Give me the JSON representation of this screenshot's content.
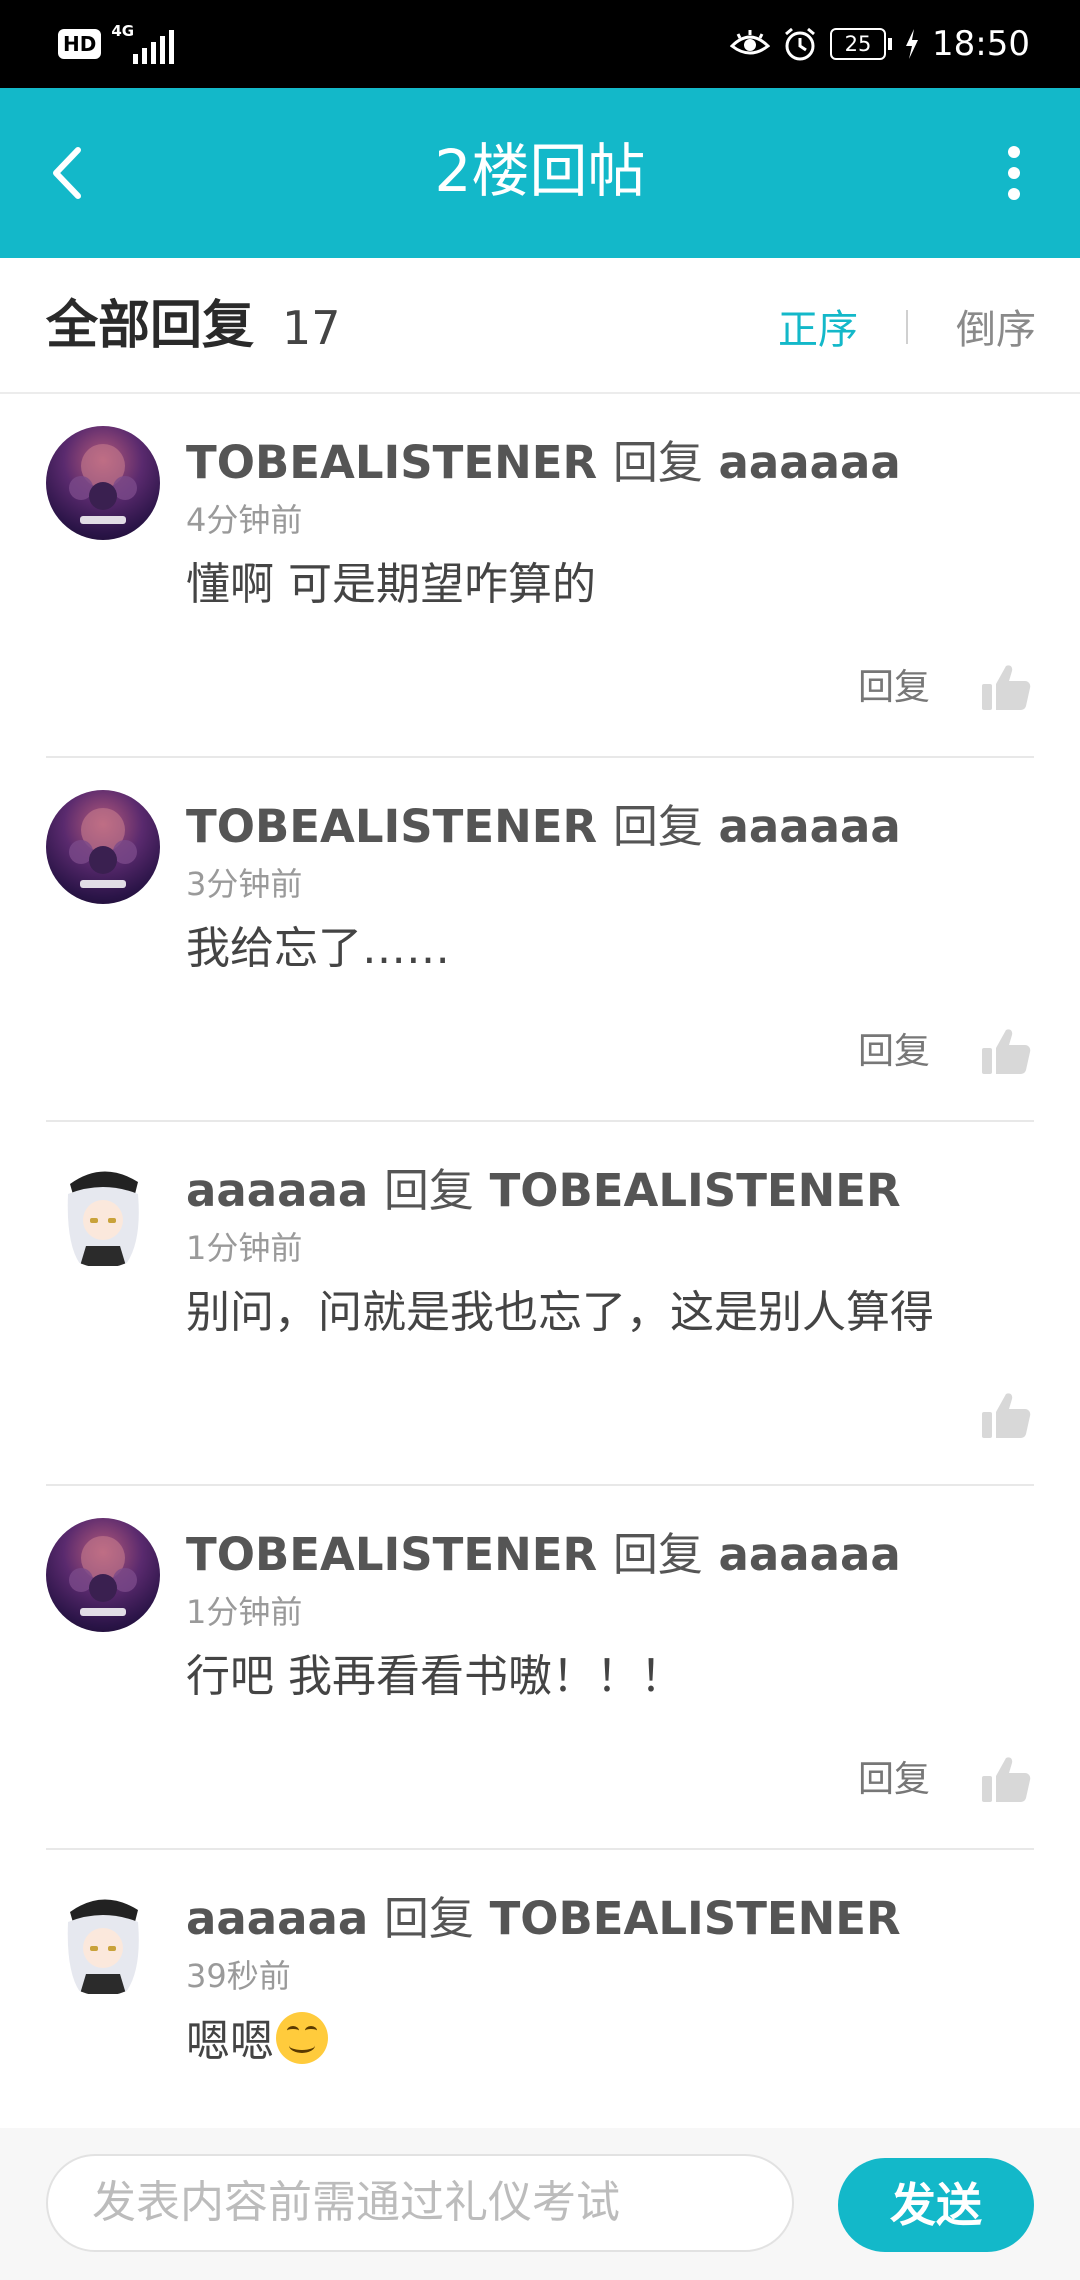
{
  "status_bar": {
    "hd": "HD",
    "network": "4G",
    "battery": "25",
    "time": "18:50"
  },
  "app_bar": {
    "title": "2楼回帖"
  },
  "reply_header": {
    "title": "全部回复",
    "count": "17",
    "sort_asc": "正序",
    "sort_desc": "倒序"
  },
  "replies": [
    {
      "user": "TOBEALISTENER",
      "verb": "回复",
      "target": "aaaaaa",
      "time": "4分钟前",
      "content": "懂啊 可是期望咋算的",
      "reply_label": "回复",
      "avatar": "avengers-poster"
    },
    {
      "user": "TOBEALISTENER",
      "verb": "回复",
      "target": "aaaaaa",
      "time": "3分钟前",
      "content": "我给忘了……",
      "reply_label": "回复",
      "avatar": "avengers-poster"
    },
    {
      "user": "aaaaaa",
      "verb": "回复",
      "target": "TOBEALISTENER",
      "time": "1分钟前",
      "content": "别问，问就是我也忘了，这是别人算得",
      "reply_label": "",
      "avatar": "anime-girl"
    },
    {
      "user": "TOBEALISTENER",
      "verb": "回复",
      "target": "aaaaaa",
      "time": "1分钟前",
      "content": "行吧 我再看看书嗷！！！",
      "reply_label": "回复",
      "avatar": "avengers-poster"
    },
    {
      "user": "aaaaaa",
      "verb": "回复",
      "target": "TOBEALISTENER",
      "time": "39秒前",
      "content": "嗯嗯",
      "reply_label": "",
      "avatar": "anime-girl"
    }
  ],
  "input_bar": {
    "placeholder": "发表内容前需通过礼仪考试",
    "send_label": "发送"
  },
  "colors": {
    "accent": "#13b8c9",
    "status_bar": "#000000"
  }
}
